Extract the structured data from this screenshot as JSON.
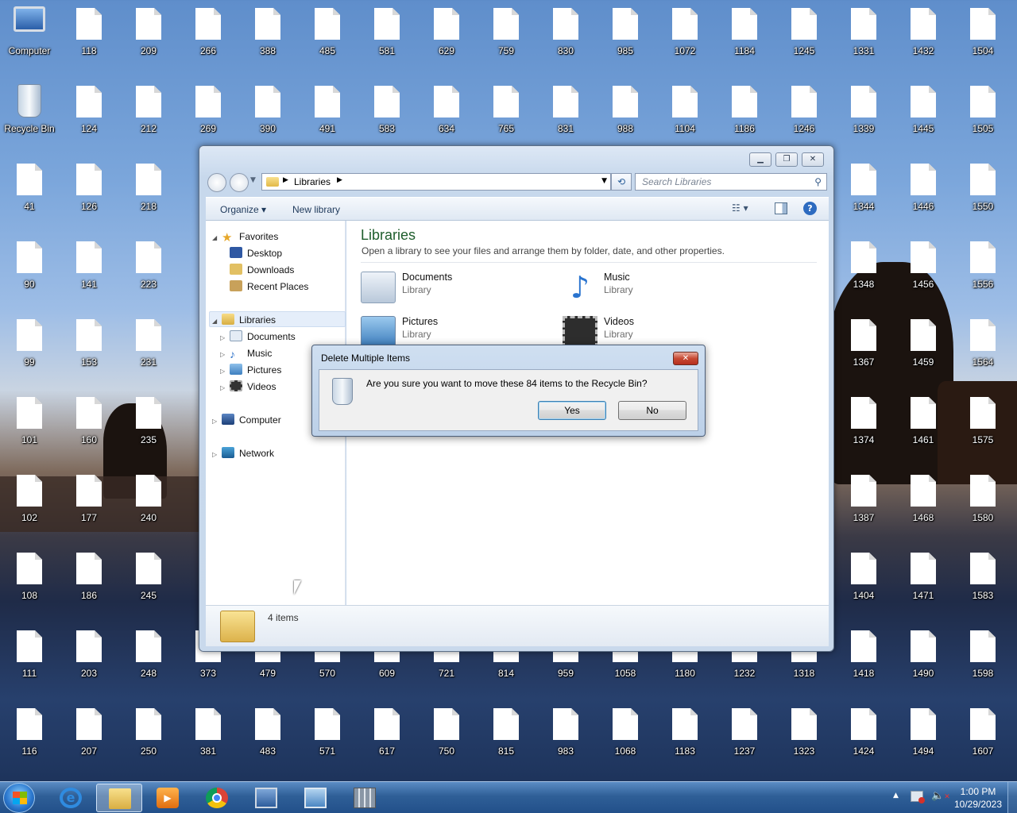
{
  "desktop": {
    "special": [
      {
        "label": "Computer",
        "icon": "computer-icon"
      },
      {
        "label": "Recycle Bin",
        "icon": "recycle-bin-icon"
      }
    ],
    "columns": [
      [
        "Computer",
        "Recycle Bin",
        "41",
        "90",
        "99",
        "101",
        "102",
        "108",
        "111",
        "116"
      ],
      [
        "118",
        "124",
        "126",
        "141",
        "153",
        "160",
        "177",
        "186",
        "203",
        "207"
      ],
      [
        "209",
        "212",
        "218",
        "223",
        "231",
        "235",
        "240",
        "245",
        "248",
        "250"
      ],
      [
        "266",
        "269",
        "",
        "",
        "",
        "",
        "",
        "",
        "373",
        "381"
      ],
      [
        "388",
        "390",
        "",
        "",
        "",
        "",
        "",
        "",
        "479",
        "483"
      ],
      [
        "485",
        "491",
        "",
        "",
        "",
        "",
        "",
        "",
        "570",
        "571"
      ],
      [
        "581",
        "583",
        "",
        "",
        "",
        "",
        "",
        "",
        "609",
        "617"
      ],
      [
        "629",
        "634",
        "",
        "",
        "",
        "",
        "",
        "",
        "721",
        "750"
      ],
      [
        "759",
        "765",
        "",
        "",
        "",
        "",
        "",
        "",
        "814",
        "815"
      ],
      [
        "830",
        "831",
        "",
        "",
        "",
        "",
        "",
        "",
        "959",
        "983"
      ],
      [
        "985",
        "988",
        "",
        "",
        "",
        "",
        "",
        "",
        "1058",
        "1068"
      ],
      [
        "1072",
        "1104",
        "",
        "",
        "",
        "",
        "",
        "",
        "1180",
        "1183"
      ],
      [
        "1184",
        "1186",
        "",
        "",
        "",
        "",
        "",
        "",
        "1232",
        "1237"
      ],
      [
        "1245",
        "1246",
        "",
        "",
        "",
        "",
        "",
        "",
        "1318",
        "1323"
      ],
      [
        "1331",
        "1339",
        "1344",
        "1348",
        "1367",
        "1374",
        "1387",
        "1404",
        "1418",
        "1424"
      ],
      [
        "1432",
        "1445",
        "1446",
        "1456",
        "1459",
        "1461",
        "1468",
        "1471",
        "1490",
        "1494"
      ],
      [
        "1504",
        "1505",
        "1550",
        "1556",
        "1564",
        "1575",
        "1580",
        "1583",
        "1598",
        "1607"
      ]
    ]
  },
  "explorer": {
    "breadcrumb": "Libraries",
    "search_placeholder": "Search Libraries",
    "toolbar": {
      "organize": "Organize",
      "new_library": "New library"
    },
    "nav": {
      "favorites": "Favorites",
      "fav_items": [
        "Desktop",
        "Downloads",
        "Recent Places"
      ],
      "libraries": "Libraries",
      "lib_items": [
        "Documents",
        "Music",
        "Pictures",
        "Videos"
      ],
      "computer": "Computer",
      "network": "Network"
    },
    "content": {
      "title": "Libraries",
      "subtitle": "Open a library to see your files and arrange them by folder, date, and other properties.",
      "libraries": [
        {
          "name": "Documents",
          "type": "Library"
        },
        {
          "name": "Music",
          "type": "Library"
        },
        {
          "name": "Pictures",
          "type": "Library"
        },
        {
          "name": "Videos",
          "type": "Library"
        }
      ]
    },
    "status": "4 items"
  },
  "dialog": {
    "title": "Delete Multiple Items",
    "message": "Are you sure you want to move these 84 items to the Recycle Bin?",
    "yes": "Yes",
    "no": "No",
    "close": "✕"
  },
  "taskbar": {
    "items": [
      "start-orb",
      "internet-explorer-icon",
      "windows-explorer-icon",
      "media-player-icon",
      "chrome-icon",
      "remote-desktop-icon",
      "control-panel-icon",
      "calculator-icon"
    ],
    "time": "1:00 PM",
    "date": "10/29/2023"
  }
}
